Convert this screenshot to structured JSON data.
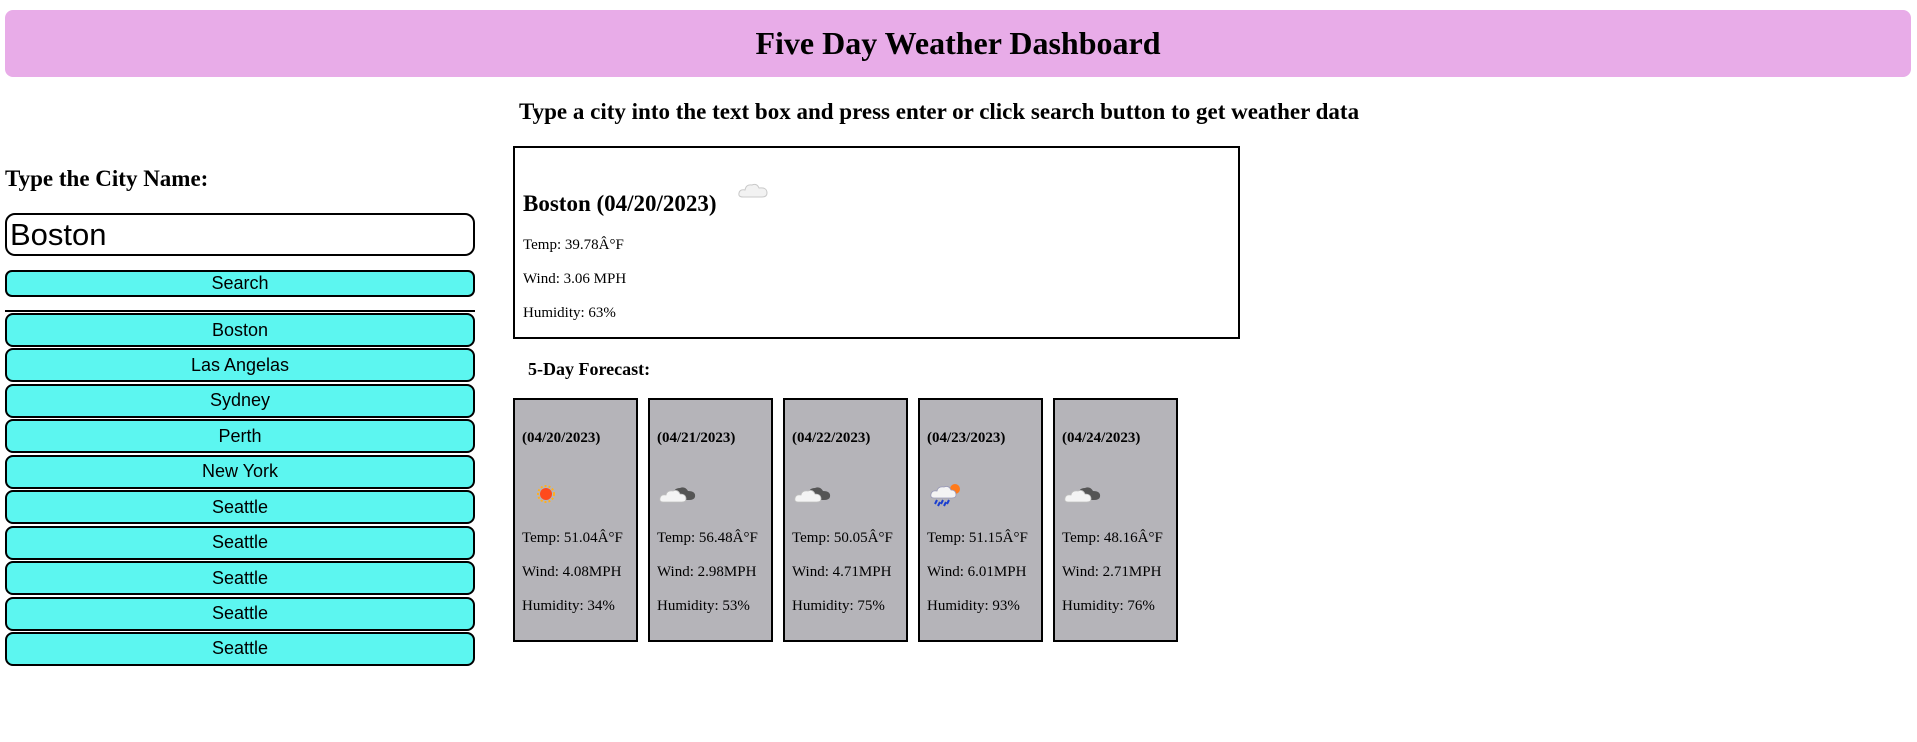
{
  "header": {
    "title": "Five Day Weather Dashboard"
  },
  "instructions": "Type a city into the text box and press enter or click search button to get weather data",
  "sidebar": {
    "label": "Type the City Name:",
    "input_value": "Boston",
    "search_label": "Search",
    "history": [
      "Boston",
      "Las Angelas",
      "Sydney",
      "Perth",
      "New York",
      "Seattle",
      "Seattle",
      "Seattle",
      "Seattle",
      "Seattle"
    ]
  },
  "current": {
    "title": "Boston (04/20/2023)",
    "icon": "cloud-icon",
    "temp": "Temp: 39.78Â°F",
    "wind": "Wind: 3.06 MPH",
    "humidity": "Humidity: 63%"
  },
  "forecast_title": "5-Day Forecast:",
  "forecast": [
    {
      "date": "(04/20/2023)",
      "icon": "sun-icon",
      "temp": "Temp: 51.04Â°F",
      "wind": "Wind: 4.08MPH",
      "humidity": "Humidity: 34%"
    },
    {
      "date": "(04/21/2023)",
      "icon": "cloudy-icon",
      "temp": "Temp: 56.48Â°F",
      "wind": "Wind: 2.98MPH",
      "humidity": "Humidity: 53%"
    },
    {
      "date": "(04/22/2023)",
      "icon": "cloudy-icon",
      "temp": "Temp: 50.05Â°F",
      "wind": "Wind: 4.71MPH",
      "humidity": "Humidity: 75%"
    },
    {
      "date": "(04/23/2023)",
      "icon": "rain-sun-icon",
      "temp": "Temp: 51.15Â°F",
      "wind": "Wind: 6.01MPH",
      "humidity": "Humidity: 93%"
    },
    {
      "date": "(04/24/2023)",
      "icon": "cloudy-icon",
      "temp": "Temp: 48.16Â°F",
      "wind": "Wind: 2.71MPH",
      "humidity": "Humidity: 76%"
    }
  ],
  "colors": {
    "header_bg": "#e8ace8",
    "button_bg": "#5cf6f0",
    "card_bg": "#b5b4b9"
  }
}
